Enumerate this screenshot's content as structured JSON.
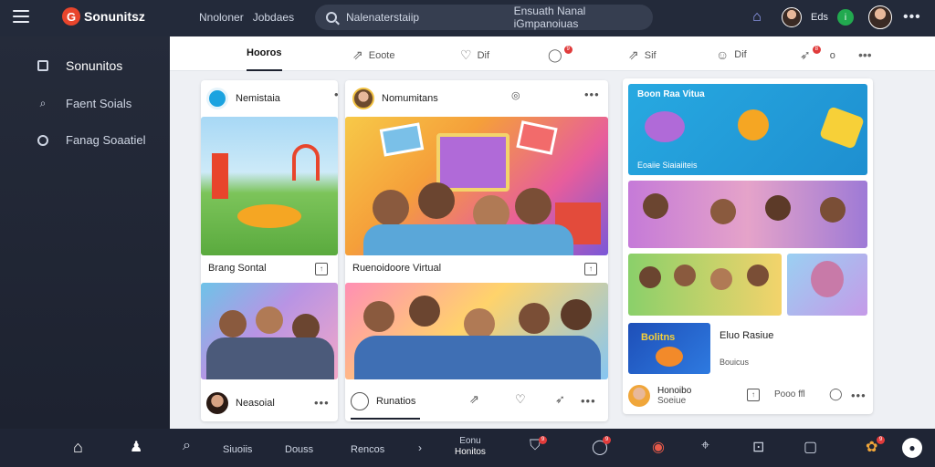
{
  "app": {
    "logo_mark": "G",
    "name": "Sonunitsz"
  },
  "topnav": [
    "Nnoloner",
    "Jobdaes"
  ],
  "search": {
    "placeholder": "Nalenaterstaiip",
    "hint": "Ensuath Nanal iGmpanoiuas"
  },
  "top_right": {
    "user_label": "Eds",
    "status_glyph": "i"
  },
  "sidebar": {
    "items": [
      {
        "label": "Sonunitos",
        "icon": "square-icon"
      },
      {
        "label": "Faent Soials",
        "icon": "search-icon"
      },
      {
        "label": "Fanag Soaatiel",
        "icon": "circle-icon"
      }
    ]
  },
  "tabs": [
    {
      "label": "Hooros",
      "icon": "",
      "badge": ""
    },
    {
      "label": "Eoote",
      "icon": "share-icon",
      "badge": ""
    },
    {
      "label": "Dif",
      "icon": "heart-icon",
      "badge": ""
    },
    {
      "label": "",
      "icon": "comment-icon",
      "badge": "9"
    },
    {
      "label": "Sif",
      "icon": "share-icon",
      "badge": ""
    },
    {
      "label": "Dif",
      "icon": "smile-icon",
      "badge": ""
    },
    {
      "label": "o",
      "icon": "send-icon",
      "badge": "8"
    }
  ],
  "cards": {
    "c1": {
      "author": "Nemistaia",
      "caption1": "Brang Sontal",
      "caption2": "Neasoial"
    },
    "c2": {
      "author": "Nomumitans",
      "caption1": "Ruenoidoore Virtual",
      "caption2": "Runatios"
    },
    "c3": {
      "banner_title": "Boon Raa Vitua",
      "banner_caption": "Eoaiie Siaiaiiteis",
      "tile_title": "Bolitns",
      "list_title": "Eluo Rasiue",
      "list_sub": "Bouicus",
      "author": "Honoibo",
      "author_sub": "Soeiue",
      "side_label": "Pooo ffl"
    }
  },
  "bottom": {
    "labels": [
      "Siuoiis",
      "Douss",
      "Rencos"
    ],
    "center_top": "Eonu",
    "center_bottom": "Honitos",
    "badges": [
      "9",
      "9",
      "9"
    ]
  },
  "colors": {
    "accent": "#e8452c",
    "topbar": "#232a3a",
    "sidebar": "#252b3a",
    "banner": "#27a9e1",
    "badge": "#e03b3b",
    "online": "#22a94f"
  }
}
